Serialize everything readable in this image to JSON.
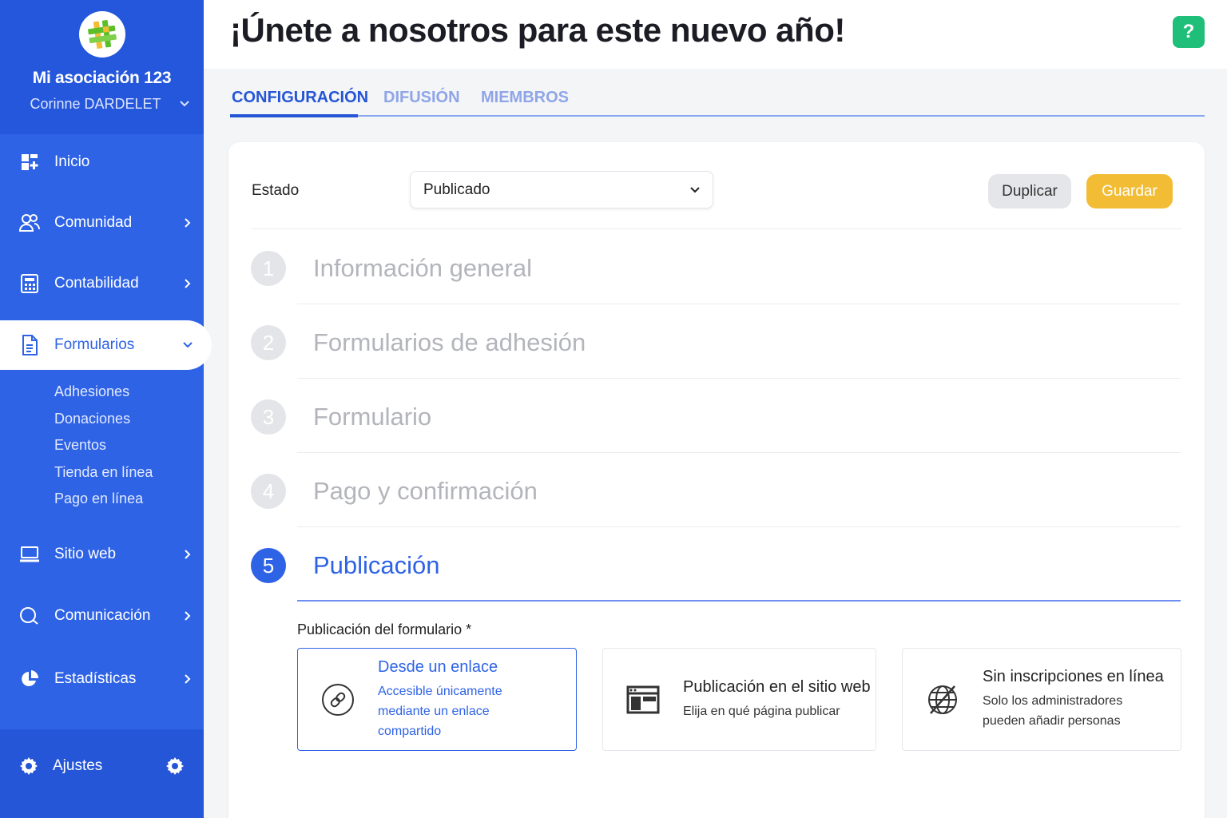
{
  "sidebar": {
    "org_name": "Mi asociación 123",
    "user_name": "Corinne DARDELET",
    "items": [
      {
        "label": "Inicio",
        "icon": "dashboard-icon"
      },
      {
        "label": "Comunidad",
        "icon": "people-icon"
      },
      {
        "label": "Contabilidad",
        "icon": "calculator-icon"
      },
      {
        "label": "Formularios",
        "icon": "document-icon"
      },
      {
        "label": "Sitio web",
        "icon": "laptop-icon"
      },
      {
        "label": "Comunicación",
        "icon": "chat-icon"
      },
      {
        "label": "Estadísticas",
        "icon": "pie-chart-icon"
      }
    ],
    "subitems": [
      "Adhesiones",
      "Donaciones",
      "Eventos",
      "Tienda en línea",
      "Pago en línea"
    ],
    "settings_label": "Ajustes",
    "accent": "#2e63e6"
  },
  "header": {
    "title": "¡Únete a nosotros para este nuevo año!",
    "help_label": "?"
  },
  "tabs": [
    "CONFIGURACIÓN",
    "DIFUSIÓN",
    "MIEMBROS"
  ],
  "form": {
    "estado_label": "Estado",
    "estado_value": "Publicado",
    "duplicate_label": "Duplicar",
    "save_label": "Guardar",
    "steps": [
      {
        "num": "1",
        "title": "Información general"
      },
      {
        "num": "2",
        "title": "Formularios de adhesión"
      },
      {
        "num": "3",
        "title": "Formulario"
      },
      {
        "num": "4",
        "title": "Pago y confirmación"
      },
      {
        "num": "5",
        "title": "Publicación"
      }
    ],
    "publication_label": "Publicación del formulario *",
    "options": [
      {
        "title": "Desde un enlace",
        "desc": "Accesible únicamente mediante un enlace compartido",
        "icon": "link-icon",
        "selected": true
      },
      {
        "title": "Publicación en el sitio web",
        "desc": "Elija en qué página publicar",
        "icon": "website-icon",
        "selected": false
      },
      {
        "title": "Sin inscripciones en línea",
        "desc": "Solo los administradores pueden añadir personas",
        "icon": "globe-off-icon",
        "selected": false
      }
    ]
  }
}
